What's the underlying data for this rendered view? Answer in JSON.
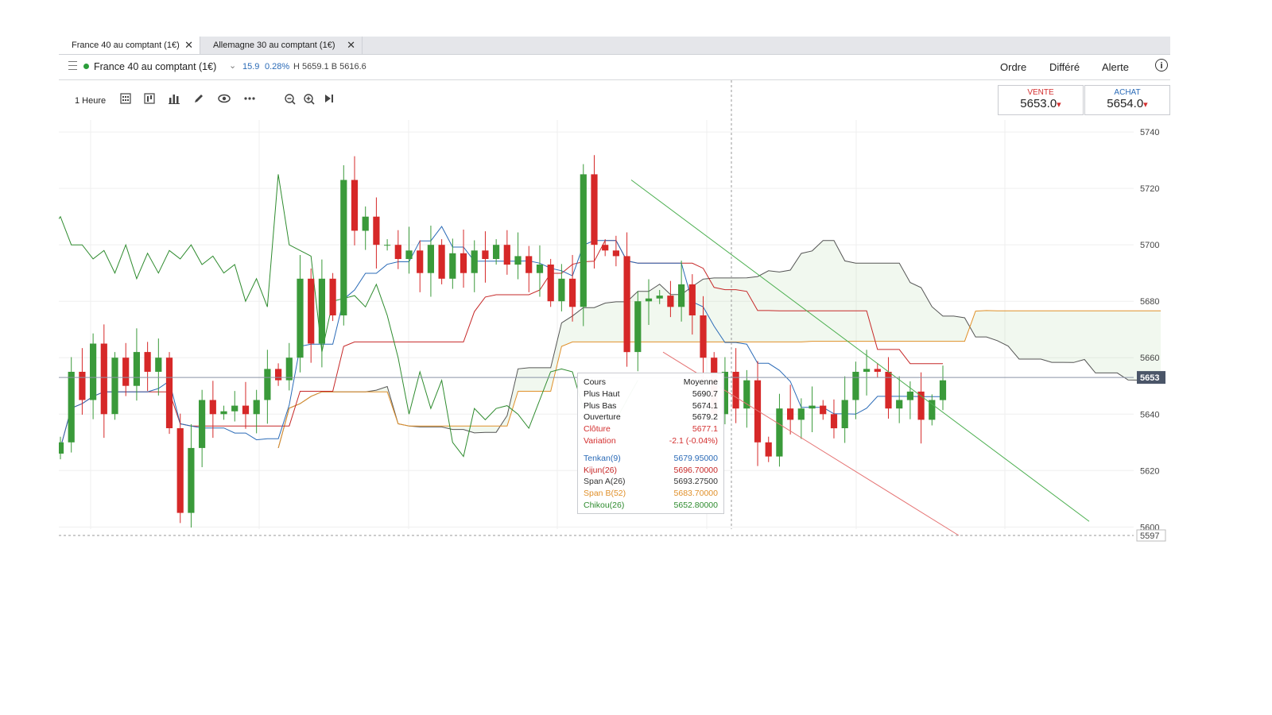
{
  "tabs": [
    {
      "label": "France 40 au comptant (1€)",
      "close": "✕"
    },
    {
      "label": "Allemagne 30 au comptant (1€)",
      "close": "✕"
    }
  ],
  "header": {
    "instrument": "France 40 au comptant (1€)",
    "change": "15.9",
    "change_pct": "0.28%",
    "high_low": "H 5659.1  B 5616.6",
    "actions": [
      "Ordre",
      "Différé",
      "Alerte"
    ],
    "info": "i"
  },
  "toolbar": {
    "timeframe": "1 Heure",
    "icons": [
      "calendar-grid-icon",
      "candle-type-icon",
      "indicators-icon",
      "draw-pencil-icon",
      "eye-icon",
      "more-icon",
      "zoom-out-icon",
      "zoom-in-icon",
      "jump-to-latest-icon"
    ]
  },
  "prices": {
    "sell": {
      "label": "VENTE",
      "value": "5653.0",
      "arrow": "▾",
      "color": "#d32f2f"
    },
    "buy": {
      "label": "ACHAT",
      "value": "5654.0",
      "arrow": "▾",
      "color": "#2b6bb7"
    }
  },
  "axis": {
    "ticks": [
      "5740",
      "5720",
      "5700",
      "5680",
      "5660",
      "5640",
      "5620",
      "5600"
    ],
    "current_price": "5653",
    "bottom_price": "5597"
  },
  "tooltip": {
    "header_left": "Cours",
    "header_right": "Moyenne",
    "rows": [
      {
        "label": "Plus Haut",
        "value": "5690.7",
        "color": "#222222"
      },
      {
        "label": "Plus Bas",
        "value": "5674.1",
        "color": "#222222"
      },
      {
        "label": "Ouverture",
        "value": "5679.2",
        "color": "#222222"
      },
      {
        "label": "Clôture",
        "value": "5677.1",
        "color": "#d32f2f"
      },
      {
        "label": "Variation",
        "value": "-2.1 (-0.04%)",
        "color": "#d32f2f"
      }
    ],
    "indicators": [
      {
        "label": "Tenkan(9)",
        "value": "5679.95000",
        "color": "#2b6bb7"
      },
      {
        "label": "Kijun(26)",
        "value": "5696.70000",
        "color": "#c62828"
      },
      {
        "label": "Span A(26)",
        "value": "5693.27500",
        "color": "#333333"
      },
      {
        "label": "Span B(52)",
        "value": "5683.70000",
        "color": "#e0902a"
      },
      {
        "label": "Chikou(26)",
        "value": "5652.80000",
        "color": "#2e8b2e"
      }
    ]
  },
  "chart_data": {
    "type": "candlestick",
    "ylim": [
      5597,
      5742
    ],
    "closes": [
      5630,
      5655,
      5645,
      5665,
      5640,
      5660,
      5650,
      5662,
      5655,
      5660,
      5635,
      5605,
      5628,
      5645,
      5640,
      5641,
      5643,
      5640,
      5645,
      5656,
      5652,
      5660,
      5688,
      5665,
      5688,
      5675,
      5723,
      5705,
      5710,
      5700,
      5700,
      5695,
      5698,
      5690,
      5700,
      5688,
      5697,
      5690,
      5698,
      5695,
      5700,
      5693,
      5696,
      5690,
      5693,
      5680,
      5688,
      5678,
      5725,
      5700,
      5698,
      5696,
      5662,
      5680,
      5681,
      5682,
      5678,
      5686,
      5675,
      5660,
      5640,
      5655,
      5642,
      5652,
      5630,
      5625,
      5642,
      5638,
      5642,
      5643,
      5640,
      5635,
      5645,
      5655,
      5656,
      5655,
      5642,
      5645,
      5648,
      5638,
      5645,
      5652
    ]
  }
}
